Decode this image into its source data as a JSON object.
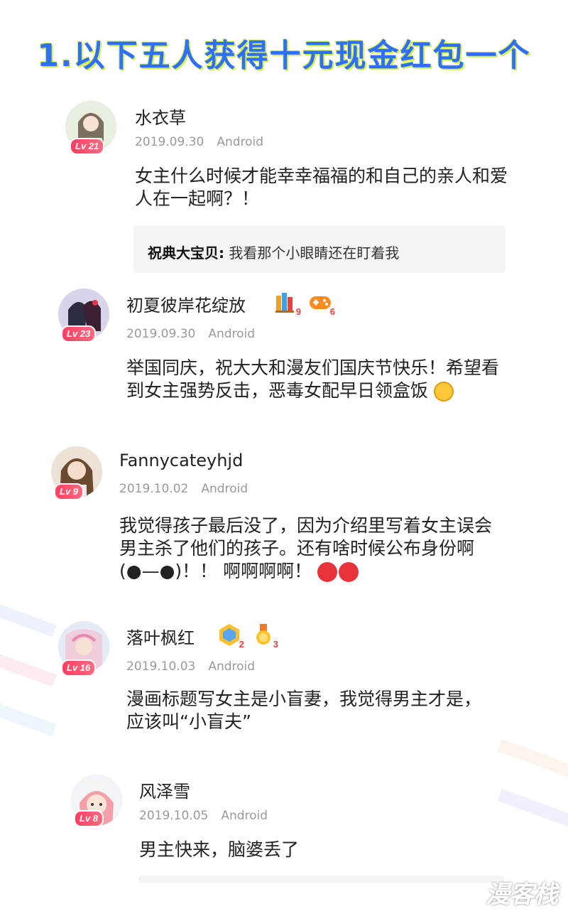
{
  "banner": {
    "title": "1.以下五人获得十元现金红包一个"
  },
  "comments": [
    {
      "username": "水衣草",
      "level": "Lv 21",
      "date": "2019.09.30",
      "platform": "Android",
      "text": "女主什么时候才能幸幸福福的和自己的亲人和爱人在一起啊？！",
      "reply": {
        "author": "祝典大宝贝:",
        "text": "我看那个小眼睛还在盯着我"
      }
    },
    {
      "username": "初夏彼岸花绽放",
      "level": "Lv 23",
      "date": "2019.09.30",
      "platform": "Android",
      "text": "举国同庆，祝大大和漫友们国庆节快乐！希望看到女主强势反击，恶毒女配早日领盒饭",
      "badges": [
        {
          "icon": "books-badge-icon",
          "count": "9"
        },
        {
          "icon": "gamepad-badge-icon",
          "count": "6"
        }
      ]
    },
    {
      "username": "Fannycateyhjd",
      "level": "Lv 9",
      "date": "2019.10.02",
      "platform": "Android",
      "text": "我觉得孩子最后没了，因为介绍里写着女主误会男主杀了他们的孩子。还有啥时候公布身份啊(●—●)！！ 啊啊啊啊！"
    },
    {
      "username": "落叶枫红",
      "level": "Lv 16",
      "date": "2019.10.03",
      "platform": "Android",
      "text": "漫画标题写女主是小盲妻，我觉得男主才是，应该叫“小盲夫”",
      "badges": [
        {
          "icon": "hexagon-badge-icon",
          "count": "2"
        },
        {
          "icon": "medal-badge-icon",
          "count": "3"
        }
      ]
    },
    {
      "username": "风泽雪",
      "level": "Lv 8",
      "date": "2019.10.05",
      "platform": "Android",
      "text": "男主快来，脑婆丢了"
    }
  ],
  "watermark": "漫客栈",
  "colors": {
    "level_badge": "#ff3f62",
    "title": "#2f6fff",
    "title_outline": "#d4f04a"
  }
}
